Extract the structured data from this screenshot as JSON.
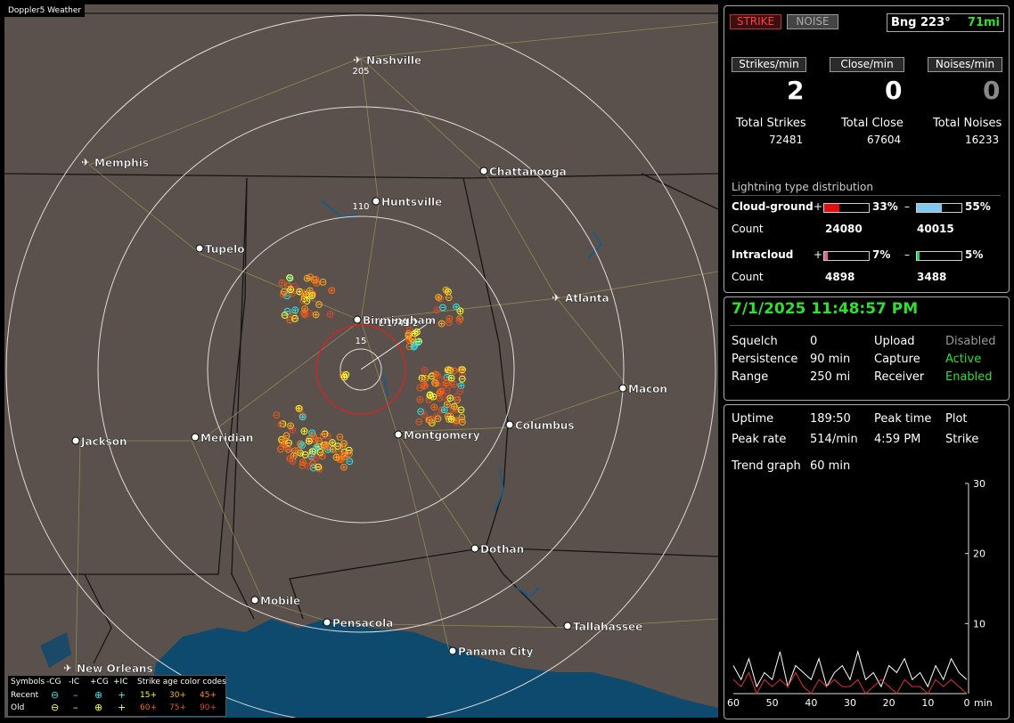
{
  "map": {
    "title": "Doppler5 Weather",
    "cities": [
      {
        "name": "Nashville",
        "kind": "airport"
      },
      {
        "name": "Memphis",
        "kind": "airport"
      },
      {
        "name": "Chattanooga",
        "kind": "dot"
      },
      {
        "name": "Huntsville",
        "kind": "dot"
      },
      {
        "name": "Tupelo",
        "kind": "dot"
      },
      {
        "name": "Birmingham",
        "kind": "dot"
      },
      {
        "name": "Atlanta",
        "kind": "airport"
      },
      {
        "name": "Macon",
        "kind": "dot"
      },
      {
        "name": "Jackson",
        "kind": "dot"
      },
      {
        "name": "Meridian",
        "kind": "dot"
      },
      {
        "name": "Montgomery",
        "kind": "dot"
      },
      {
        "name": "Columbus",
        "kind": "dot"
      },
      {
        "name": "Dothan",
        "kind": "dot"
      },
      {
        "name": "Mobile",
        "kind": "dot"
      },
      {
        "name": "Pensacola",
        "kind": "dot"
      },
      {
        "name": "Tallahassee",
        "kind": "dot"
      },
      {
        "name": "Panama City",
        "kind": "dot"
      },
      {
        "name": "New Orleans",
        "kind": "airport"
      }
    ],
    "ring_labels": [
      "205",
      "110",
      "15"
    ],
    "storm_label": "L-1741-2",
    "legend": {
      "symbols_label": "Symbols",
      "col_minus_cg": "-CG",
      "col_minus_ic": "-IC",
      "col_plus_cg": "+CG",
      "col_plus_ic": "+IC",
      "age_title": "Strike age color codes",
      "recent_label": "Recent",
      "old_label": "Old",
      "recent_ages": [
        "15+",
        "30+",
        "45+"
      ],
      "old_ages": [
        "60+",
        "75+",
        "90+"
      ],
      "age_colors": [
        "#ffff30",
        "#ffb020",
        "#ff8a20",
        "#ff6a10",
        "#e05a20",
        "#d04a30"
      ]
    }
  },
  "status": {
    "strike_btn": "STRIKE",
    "noise_btn": "NOISE",
    "bearing_label": "Bng 223°",
    "distance": "71mi",
    "rate_headers": [
      "Strikes/min",
      "Close/min",
      "Noises/min"
    ],
    "rates": [
      "2",
      "0",
      "0"
    ],
    "total_labels": [
      "Total Strikes",
      "Total Close",
      "Total Noises"
    ],
    "totals": [
      "72481",
      "67604",
      "16233"
    ],
    "dist_title": "Lightning type distribution",
    "cg_label": "Cloud-ground",
    "ic_label": "Intracloud",
    "count_label": "Count",
    "plus": "+",
    "minus": "–",
    "cg_plus_pct": "33%",
    "cg_minus_pct": "55%",
    "cg_plus_count": "24080",
    "cg_minus_count": "40015",
    "ic_plus_pct": "7%",
    "ic_minus_pct": "5%",
    "ic_plus_count": "4898",
    "ic_minus_count": "3488",
    "cg_plus_frac": 0.33,
    "cg_minus_frac": 0.55,
    "ic_plus_frac": 0.07,
    "ic_minus_frac": 0.05
  },
  "settings": {
    "datetime": "7/1/2025 11:48:57 PM",
    "squelch_label": "Squelch",
    "squelch": "0",
    "persistence_label": "Persistence",
    "persistence": "90 min",
    "range_label": "Range",
    "range": "250 mi",
    "upload_label": "Upload",
    "upload": "Disabled",
    "capture_label": "Capture",
    "capture": "Active",
    "receiver_label": "Receiver",
    "receiver": "Enabled"
  },
  "stats": {
    "uptime_label": "Uptime",
    "uptime": "189:50",
    "peak_time_label": "Peak time",
    "peak_time": "4:59 PM",
    "plot_label": "Plot",
    "plot": "Strike",
    "peak_rate_label": "Peak rate",
    "peak_rate": "514/min",
    "trend_label": "Trend graph",
    "trend": "60 min",
    "x_ticks": [
      "60",
      "50",
      "40",
      "30",
      "20",
      "10",
      "0"
    ],
    "x_unit": "min",
    "y_ticks": [
      "30",
      "20",
      "10"
    ]
  },
  "chart_data": {
    "type": "line",
    "title": "",
    "xlabel": "min",
    "ylabel": "",
    "ylim": [
      0,
      30
    ],
    "x": [
      60,
      58,
      56,
      54,
      52,
      50,
      48,
      46,
      44,
      42,
      40,
      38,
      36,
      34,
      32,
      30,
      28,
      26,
      24,
      22,
      20,
      18,
      16,
      14,
      12,
      10,
      8,
      6,
      4,
      2,
      0
    ],
    "series": [
      {
        "values": [
          4,
          2,
          5,
          1,
          3,
          2,
          6,
          1,
          4,
          3,
          2,
          5,
          1,
          3,
          4,
          2,
          6,
          2,
          3,
          1,
          4,
          3,
          5,
          2,
          3,
          1,
          4,
          2,
          5,
          3,
          2
        ]
      },
      {
        "values": [
          2,
          1,
          3,
          0,
          2,
          1,
          2,
          1,
          3,
          1,
          0,
          2,
          1,
          2,
          1,
          1,
          2,
          0,
          1,
          2,
          1,
          0,
          2,
          1,
          1,
          0,
          2,
          1,
          2,
          1,
          0
        ]
      }
    ]
  }
}
